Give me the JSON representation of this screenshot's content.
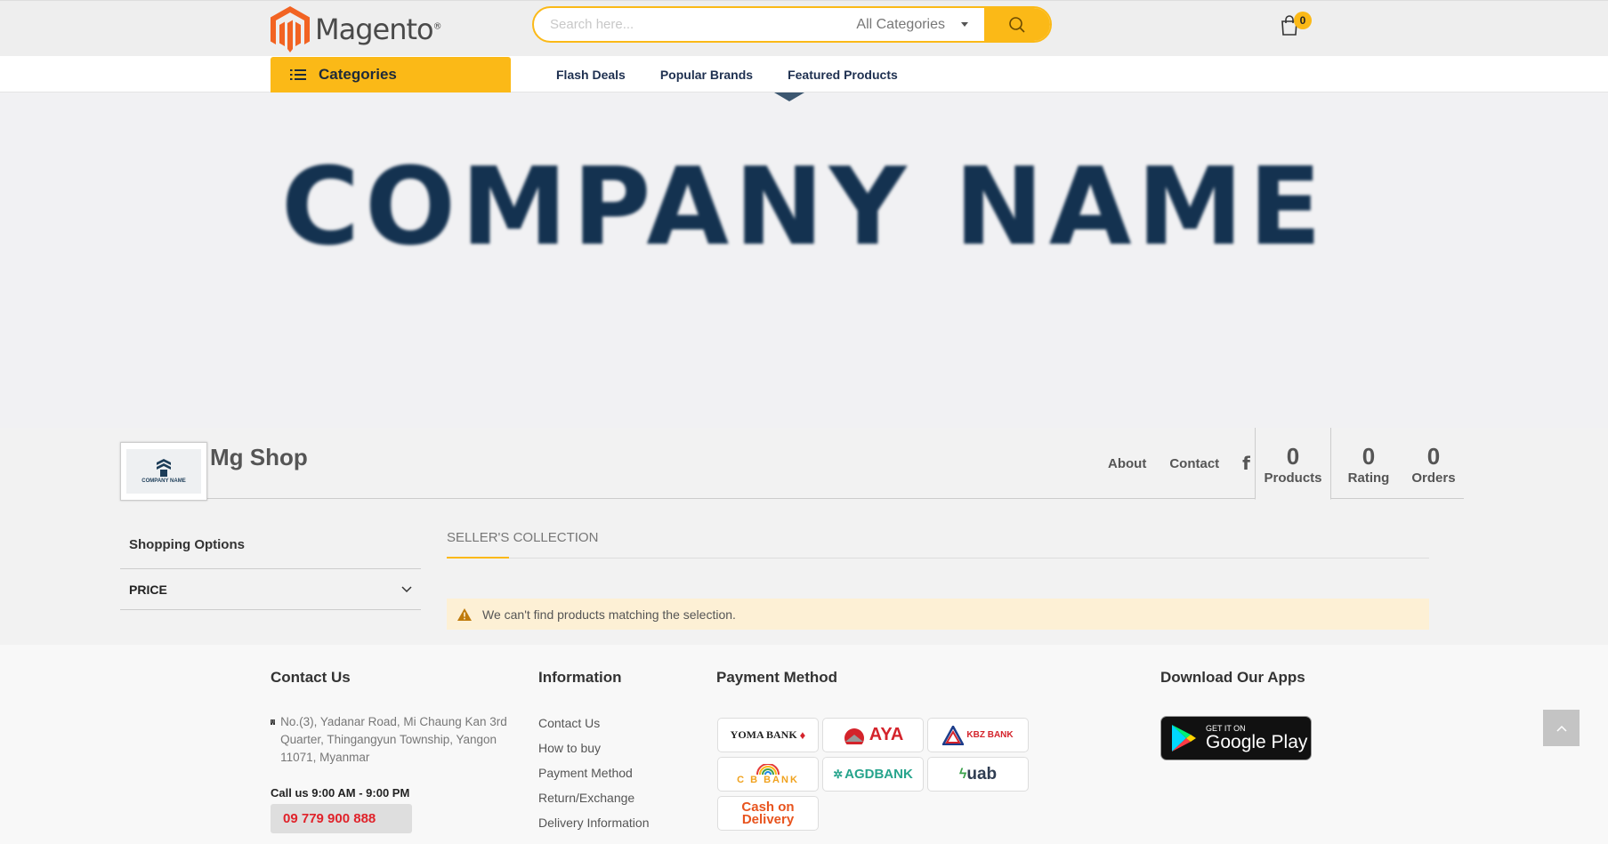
{
  "header": {
    "logo_text": "Magento",
    "logo_reg": "®",
    "search_placeholder": "Search here...",
    "search_category": "All Categories",
    "cart_count": "0"
  },
  "nav": {
    "categories_label": "Categories",
    "links": [
      "Flash Deals",
      "Popular Brands",
      "Featured Products"
    ]
  },
  "banner": {
    "title": "COMPANY NAME"
  },
  "shop": {
    "logo_caption": "COMPANY NAME",
    "name": "Mg Shop",
    "links": [
      "About",
      "Contact"
    ],
    "stats": [
      {
        "value": "0",
        "label": "Products"
      },
      {
        "value": "0",
        "label": "Rating"
      },
      {
        "value": "0",
        "label": "Orders"
      }
    ]
  },
  "sidebar": {
    "title": "Shopping Options",
    "filters": [
      "PRICE"
    ]
  },
  "collection": {
    "tab": "SELLER'S COLLECTION",
    "notice": "We can't find products matching the selection."
  },
  "footer": {
    "contact_title": "Contact Us",
    "address": "No.(3), Yadanar Road, Mi Chaung Kan 3rd Quarter, Thingangyun Township, Yangon 11071, Myanmar",
    "call_hours": "Call us 9:00 AM - 9:00 PM",
    "phone": "09 779 900 888",
    "info_title": "Information",
    "info_links": [
      "Contact Us",
      "How to buy",
      "Payment Method",
      "Return/Exchange",
      "Delivery Information"
    ],
    "payment_title": "Payment Method",
    "payment_methods": [
      {
        "name": "YOMA BANK",
        "color": "#222222"
      },
      {
        "name": "AYA",
        "color": "#d4232b"
      },
      {
        "name": "KBZ BANK",
        "color": "#d4232b"
      },
      {
        "name": "C B BANK",
        "color": "#f0a21e"
      },
      {
        "name": "AGDBANK",
        "color": "#26a48c"
      },
      {
        "name": "uab",
        "color": "#2f3d52"
      },
      {
        "name": "Cash on Delivery",
        "color": "#e8541e"
      }
    ],
    "apps_title": "Download Our Apps",
    "gplay_small": "GET IT ON",
    "gplay_big": "Google Play"
  },
  "colors": {
    "accent": "#fbb917",
    "nav_text": "#1e3050",
    "phone": "#e0222a"
  }
}
